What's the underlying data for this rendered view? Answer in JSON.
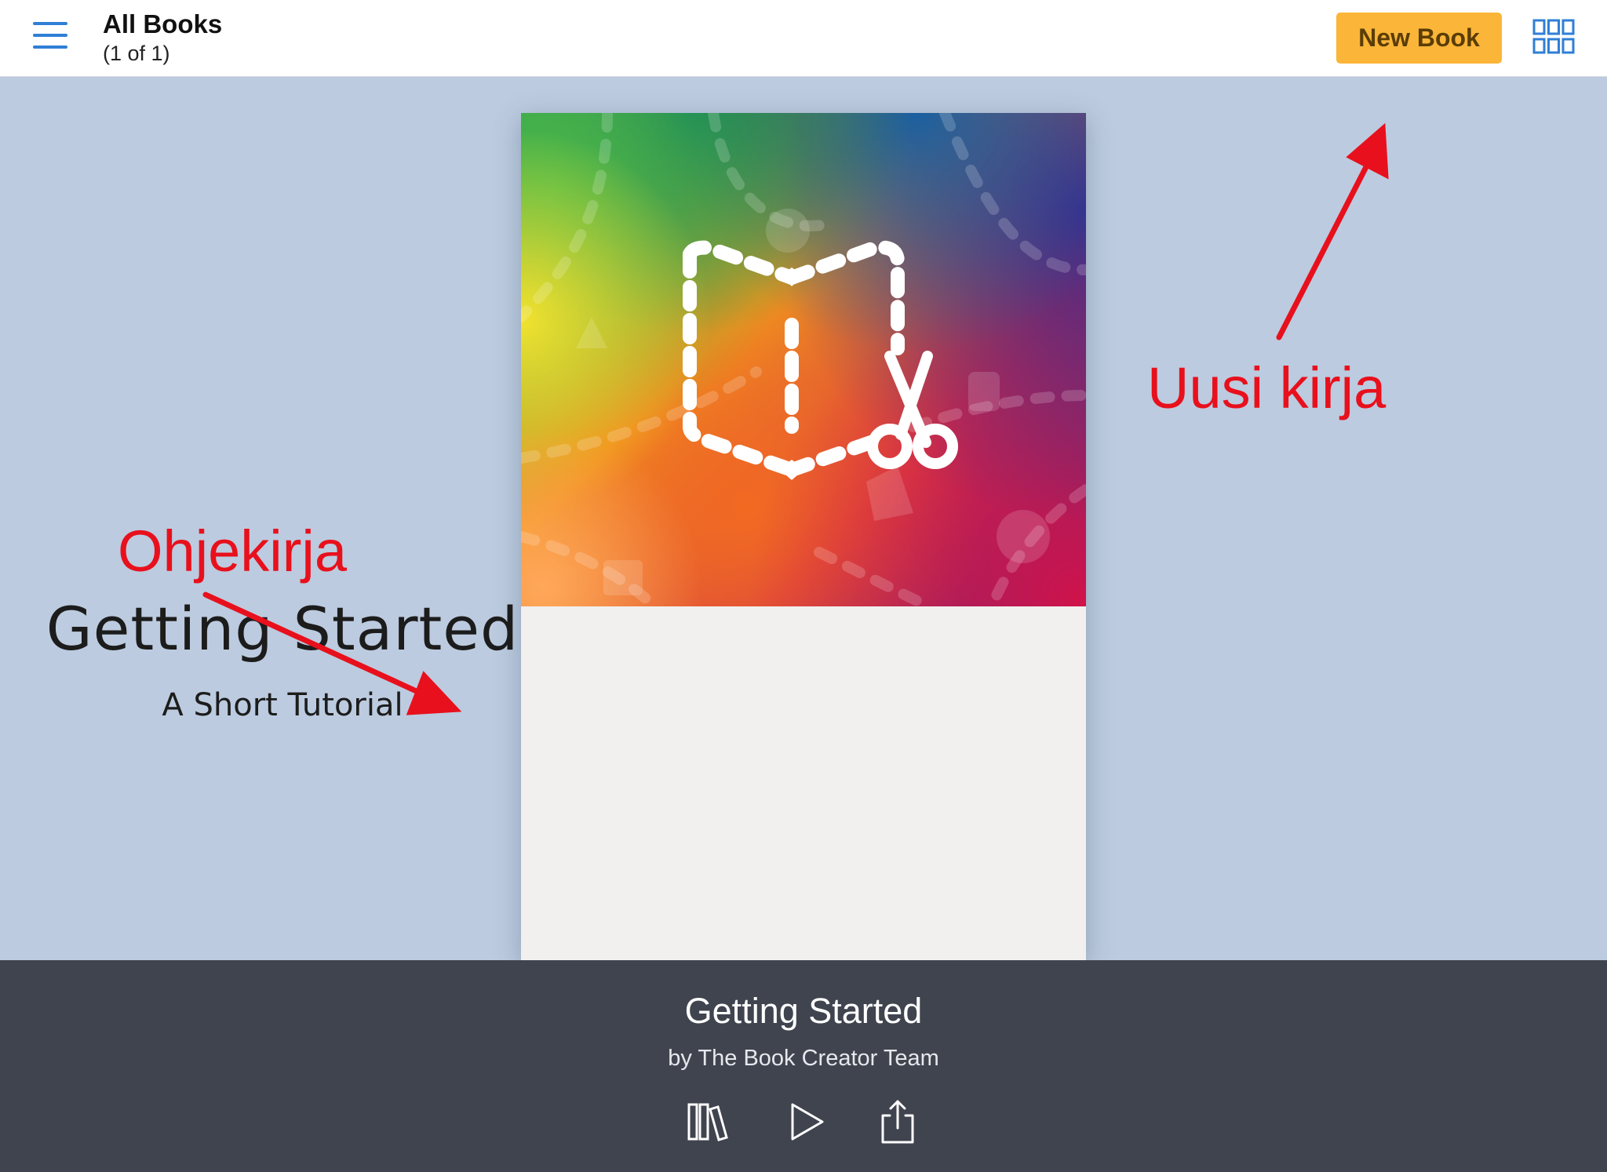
{
  "topbar": {
    "menu_icon": "hamburger-menu-icon",
    "title": "All Books",
    "count": "(1 of 1)",
    "new_book_label": "New Book",
    "grid_icon": "grid-view-icon",
    "accent_color": "#2f7fd6",
    "button_color": "#fbb538"
  },
  "book": {
    "cover_title": "Getting Started",
    "cover_subtitle": "A Short Tutorial",
    "cover_icons": [
      "book-logo-icon",
      "scissors-icon"
    ]
  },
  "annotations": {
    "left_label": "Ohjekirja",
    "right_label": "Uusi kirja",
    "color": "#e8101c"
  },
  "bottombar": {
    "title": "Getting Started",
    "author": "by The Book Creator Team",
    "icons": [
      "library-icon",
      "play-icon",
      "share-icon"
    ]
  }
}
